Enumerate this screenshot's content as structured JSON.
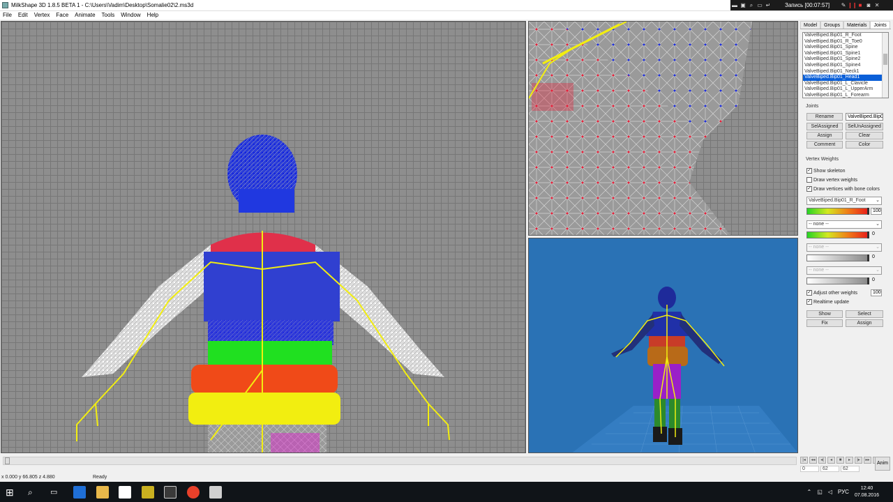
{
  "window": {
    "title": "MilkShape 3D 1.8.5 BETA 1 - C:\\Users\\Vadim\\Desktop\\Somalie02\\2.ms3d"
  },
  "recording": {
    "text": "Запись [00:07:57]"
  },
  "menu": [
    "File",
    "Edit",
    "Vertex",
    "Face",
    "Animate",
    "Tools",
    "Window",
    "Help"
  ],
  "panel": {
    "tabs": [
      "Model",
      "Groups",
      "Materials",
      "Joints"
    ],
    "joints_list": [
      "ValveBiped.Bip01_R_Foot",
      "ValveBiped.Bip01_R_Toe0",
      "ValveBiped.Bip01_Spine",
      "ValveBiped.Bip01_Spine1",
      "ValveBiped.Bip01_Spine2",
      "ValveBiped.Bip01_Spine4",
      "ValveBiped.Bip01_Neck1",
      "ValveBiped.Bip01_Head1",
      "ValveBiped.Bip01_L_Clavicle",
      "ValveBiped.Bip01_L_UpperArm",
      "ValveBiped.Bip01_L_Forearm"
    ],
    "selected_index": 7,
    "joints_label": "Joints",
    "rename": "Rename",
    "rename_value": "ValveBiped.Bip0",
    "sel_assigned": "SelAssigned",
    "sel_unassigned": "SelUnAssigned",
    "assign": "Assign",
    "clear": "Clear",
    "comment": "Comment",
    "color": "Color",
    "vertex_weights": "Vertex Weights",
    "show_skeleton": "Show skeleton",
    "draw_vertex_weights": "Draw vertex weights",
    "draw_bone_colors": "Draw vertices with bone colors",
    "bone1": "ValveBiped.Bip01_R_Foot",
    "w1": "100",
    "bone2": "-- none --",
    "w2": "0",
    "bone3": "-- none --",
    "w3": "0",
    "bone4": "-- none --",
    "w4": "0",
    "adjust_other": "Adjust other weights",
    "adjust_value": "100",
    "realtime": "Realtime update",
    "show": "Show",
    "select": "Select",
    "fix": "Fix",
    "assign2": "Assign",
    "checks": {
      "show_skeleton": true,
      "draw_vertex_weights": false,
      "draw_bone_colors": true,
      "adjust_other": true,
      "realtime": true
    }
  },
  "timeline": {
    "anim": "Anim",
    "f1": "0",
    "f2": "62",
    "f3": "62"
  },
  "status": {
    "coords": "x 0.000 y 66.805 z 4.880",
    "ready": "Ready"
  },
  "taskbar": {
    "lang": "РУС",
    "time": "12:40",
    "date": "07.08.2016"
  }
}
